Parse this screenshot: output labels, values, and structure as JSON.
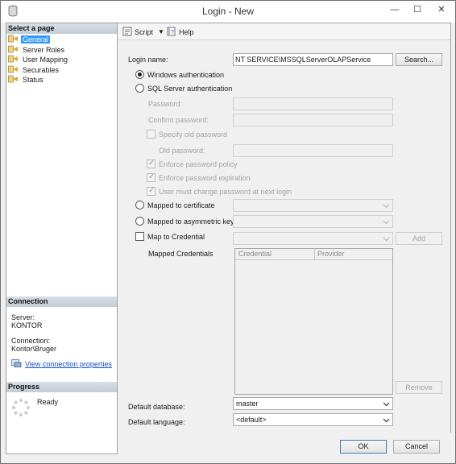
{
  "window": {
    "title": "Login - New",
    "min_glyph": "—",
    "max_glyph": "☐",
    "close_glyph": "✕"
  },
  "sidebar": {
    "select_page_header": "Select a page",
    "pages": [
      {
        "label": "General",
        "selected": true
      },
      {
        "label": "Server Roles",
        "selected": false
      },
      {
        "label": "User Mapping",
        "selected": false
      },
      {
        "label": "Securables",
        "selected": false
      },
      {
        "label": "Status",
        "selected": false
      }
    ],
    "connection_header": "Connection",
    "server_label": "Server:",
    "server_value": "KONTOR",
    "connection_label": "Connection:",
    "connection_value": "Kontor\\Bruger",
    "view_connection_link": "View connection properties",
    "progress_header": "Progress",
    "progress_status": "Ready"
  },
  "toolbar": {
    "script_label": "Script",
    "help_label": "Help"
  },
  "form": {
    "login_name_label": "Login name:",
    "login_name_value": "NT SERVICE\\MSSQLServerOLAPService",
    "search_button": "Search...",
    "windows_auth_label": "Windows authentication",
    "windows_auth_selected": true,
    "sql_auth_label": "SQL Server authentication",
    "sql_auth_selected": false,
    "password_label": "Password:",
    "confirm_password_label": "Confirm password:",
    "specify_old_password_label": "Specify old password",
    "old_password_label": "Old password:",
    "enforce_policy_label": "Enforce password policy",
    "enforce_expiration_label": "Enforce password expiration",
    "must_change_label": "User must change password at next login",
    "mapped_certificate_label": "Mapped to certificate",
    "mapped_asymmetric_label": "Mapped to asymmetric key",
    "map_credential_label": "Map to Credential",
    "add_button": "Add",
    "mapped_credentials_label": "Mapped Credentials",
    "credentials_columns": [
      "Credential",
      "Provider"
    ],
    "remove_button": "Remove",
    "default_database_label": "Default database:",
    "default_database_value": "master",
    "default_language_label": "Default language:",
    "default_language_value": "<default>"
  },
  "footer": {
    "ok_button": "OK",
    "cancel_button": "Cancel"
  },
  "colors": {
    "selection": "#3399ff",
    "link": "#1a4fc9",
    "disabled_text": "#a3a3a3"
  }
}
